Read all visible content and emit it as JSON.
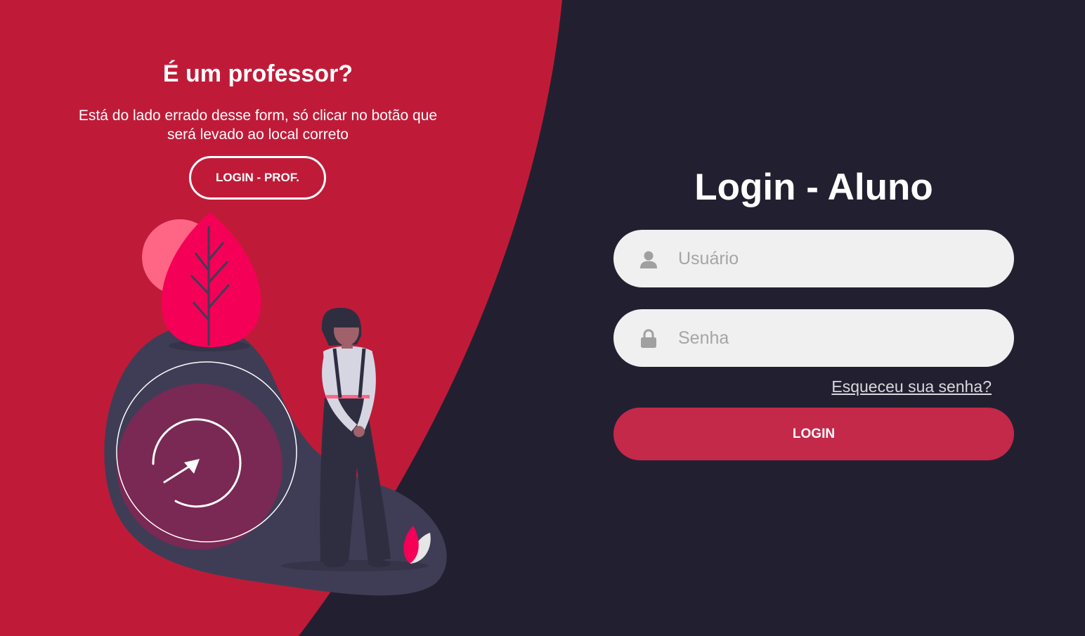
{
  "colors": {
    "accent": "#bf1b38",
    "dark": "#222030",
    "input_bg": "#f0f0f0",
    "button": "#c4294a"
  },
  "left": {
    "title": "É um professor?",
    "text": "Está do lado errado desse form, só clicar no botão que será levado ao local correto",
    "button_label": "LOGIN - PROF."
  },
  "login": {
    "title": "Login - Aluno",
    "username_icon": "user-icon",
    "username_placeholder": "Usuário",
    "password_icon": "lock-icon",
    "password_placeholder": "Senha",
    "forgot_label": "Esqueceu sua senha?",
    "submit_label": "LOGIN"
  }
}
